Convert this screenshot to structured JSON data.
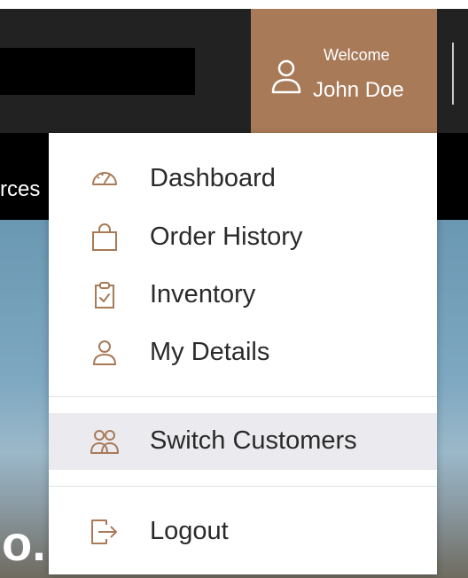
{
  "header": {
    "account": {
      "welcome_label": "Welcome",
      "user_name": "John Doe",
      "icon": "user-icon"
    }
  },
  "nav": {
    "partial_item_label": "rces"
  },
  "hero": {
    "partial_text": "o."
  },
  "account_menu": {
    "items": [
      {
        "label": "Dashboard",
        "icon": "dashboard-gauge-icon"
      },
      {
        "label": "Order History",
        "icon": "shopping-bag-icon"
      },
      {
        "label": "Inventory",
        "icon": "clipboard-check-icon"
      },
      {
        "label": "My Details",
        "icon": "user-icon"
      },
      {
        "label": "Switch Customers",
        "icon": "users-icon",
        "highlighted": true
      },
      {
        "label": "Logout",
        "icon": "logout-icon"
      }
    ]
  },
  "colors": {
    "accent": "#a87a58",
    "header_bg": "#222222",
    "nav_bg": "#000000",
    "highlight_bg": "#ebebef",
    "text": "#2a2a2a"
  }
}
